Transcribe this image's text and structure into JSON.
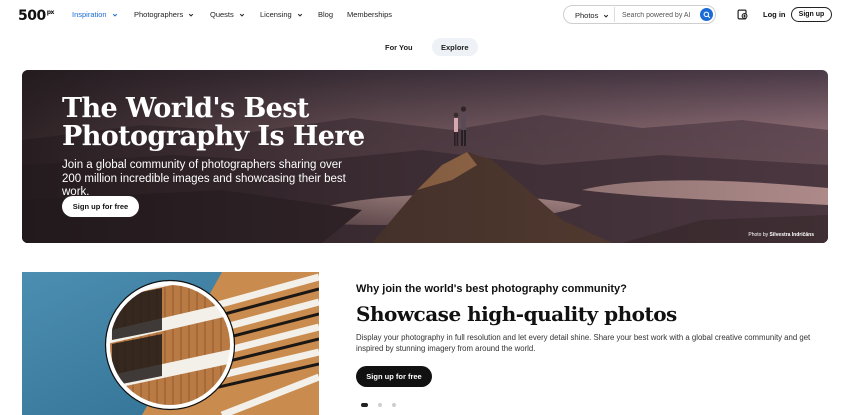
{
  "nav": {
    "logo": "500",
    "logo_sup": "px",
    "items": [
      {
        "label": "Inspiration",
        "has_dropdown": true,
        "active": true
      },
      {
        "label": "Photographers",
        "has_dropdown": true
      },
      {
        "label": "Quests",
        "has_dropdown": true
      },
      {
        "label": "Licensing",
        "has_dropdown": true
      },
      {
        "label": "Blog",
        "has_dropdown": false
      },
      {
        "label": "Memberships",
        "has_dropdown": false
      }
    ],
    "search": {
      "category": "Photos",
      "placeholder": "Search powered by AI"
    },
    "login_label": "Log in",
    "signup_label": "Sign up"
  },
  "tabs": [
    {
      "label": "For You",
      "active": false
    },
    {
      "label": "Explore",
      "active": true
    }
  ],
  "hero": {
    "title_line1": "The World's Best",
    "title_line2": "Photography Is Here",
    "subtitle": "Join a global community of photographers sharing over 200 million incredible images and showcasing their best work.",
    "cta_label": "Sign up for free",
    "credit_prefix": "Photo by",
    "credit_name": "Silvestra Indričāns"
  },
  "feature": {
    "eyebrow": "Why join the world's best photography community?",
    "title": "Showcase high-quality photos",
    "description": "Display your photography in full resolution and let every detail shine. Share your best work with a global creative community and get inspired by stunning imagery from around the world.",
    "cta_label": "Sign up for free",
    "carousel": {
      "count": 3,
      "active_index": 0
    }
  },
  "colors": {
    "accent": "#1a6bd6",
    "dark": "#111111"
  }
}
